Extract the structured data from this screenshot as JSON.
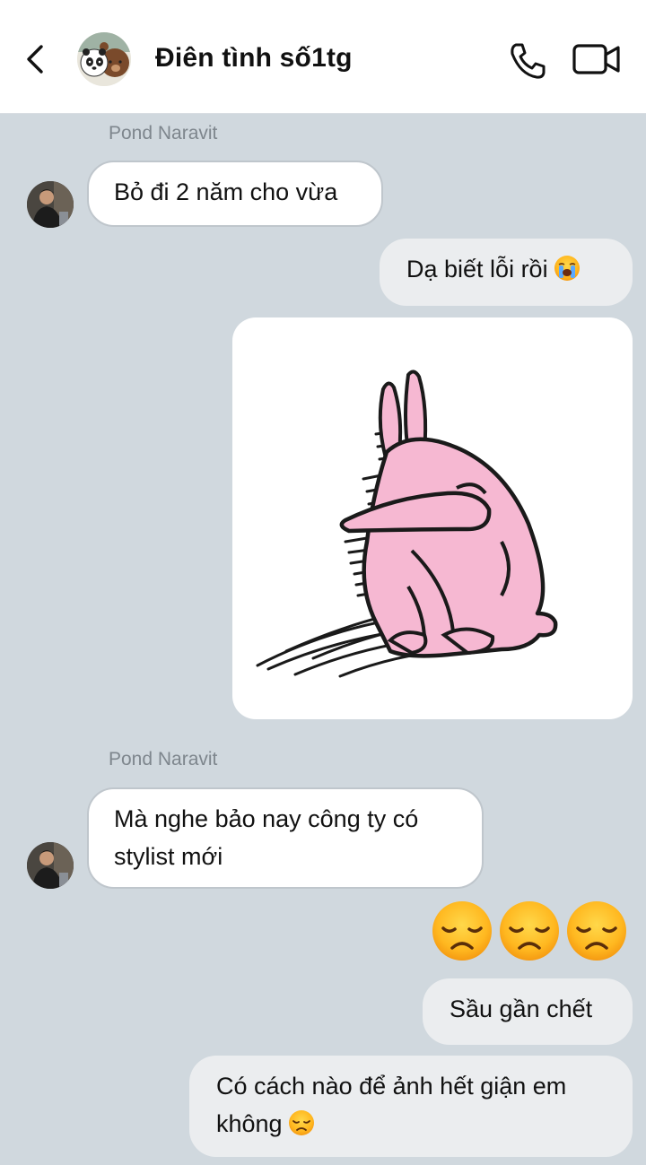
{
  "header": {
    "title": "Điên tình số1tg",
    "back_icon": "chevron-left-icon",
    "call_icon": "phone-icon",
    "video_icon": "video-camera-icon"
  },
  "messages": [
    {
      "sender": "Pond Naravit",
      "direction": "incoming",
      "text": "Bỏ đi 2 năm cho vừa"
    },
    {
      "direction": "outgoing",
      "text": "Dạ biết lỗi rồi",
      "emoji": "loudly-crying-face-icon"
    },
    {
      "direction": "outgoing",
      "type": "sticker",
      "sticker": "pink-rabbit-hugging-knees-sticker"
    },
    {
      "sender": "Pond Naravit",
      "direction": "incoming",
      "text_line1": "Mà nghe bảo nay công ty có",
      "text_line2": "stylist mới"
    },
    {
      "direction": "outgoing",
      "type": "emoji",
      "emojis": [
        "disappointed-face-icon",
        "disappointed-face-icon",
        "disappointed-face-icon"
      ]
    },
    {
      "direction": "outgoing",
      "text": "Sầu gần chết"
    },
    {
      "direction": "outgoing",
      "text_line1": "Có cách nào để ảnh hết giận em",
      "text_line2": "không",
      "emoji": "disappointed-face-icon"
    }
  ],
  "colors": {
    "chat_background": "#d0d8de",
    "incoming_bubble": "#ffffff",
    "outgoing_bubble": "#ebedef",
    "sticker_pink": "#f6b8d2"
  }
}
